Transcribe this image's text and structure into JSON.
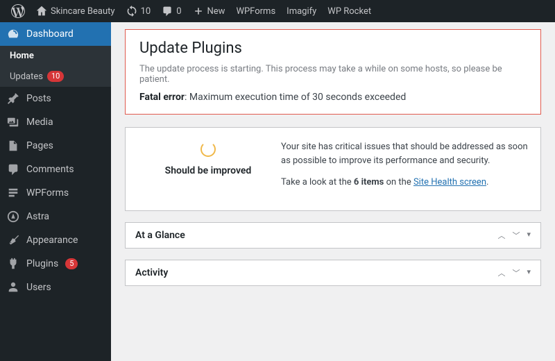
{
  "adminbar": {
    "site_name": "Skincare Beauty",
    "updates_count": "10",
    "comments_count": "0",
    "new_label": "New",
    "links": [
      "WPForms",
      "Imagify",
      "WP Rocket"
    ]
  },
  "sidebar": {
    "dashboard": "Dashboard",
    "submenu": {
      "home": "Home",
      "updates": "Updates",
      "updates_count": "10"
    },
    "items": [
      {
        "label": "Posts"
      },
      {
        "label": "Media"
      },
      {
        "label": "Pages"
      },
      {
        "label": "Comments"
      },
      {
        "label": "WPForms"
      },
      {
        "label": "Astra"
      },
      {
        "label": "Appearance"
      },
      {
        "label": "Plugins",
        "badge": "5"
      },
      {
        "label": "Users"
      }
    ]
  },
  "error_panel": {
    "title": "Update Plugins",
    "message": "The update process is starting. This process may take a while on some hosts, so please be patient.",
    "fatal_label": "Fatal error",
    "fatal_text": ": Maximum execution time of 30 seconds exceeded"
  },
  "site_health": {
    "status_label": "Should be improved",
    "para1": "Your site has critical issues that should be addressed as soon as possible to improve its performance and security.",
    "para2_a": "Take a look at the ",
    "para2_bold": "6 items",
    "para2_b": " on the ",
    "para2_link": "Site Health screen",
    "para2_c": "."
  },
  "widgets": {
    "glance": "At a Glance",
    "activity": "Activity"
  }
}
